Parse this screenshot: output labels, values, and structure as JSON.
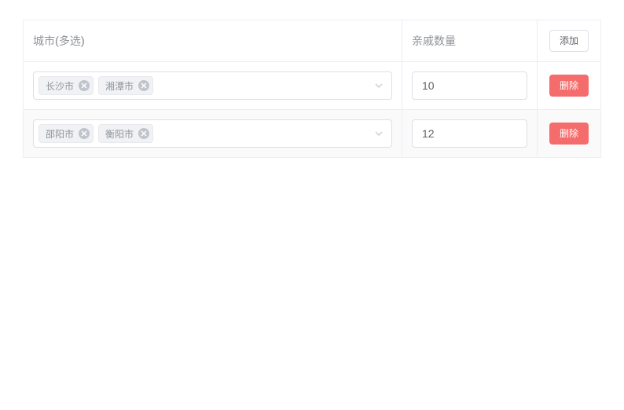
{
  "table": {
    "headers": {
      "city": "城市(多选)",
      "count": "亲戚数量"
    },
    "addButton": "添加",
    "deleteButton": "删除",
    "rows": [
      {
        "tags": [
          "长沙市",
          "湘潭市"
        ],
        "count": "10"
      },
      {
        "tags": [
          "邵阳市",
          "衡阳市"
        ],
        "count": "12"
      }
    ]
  }
}
